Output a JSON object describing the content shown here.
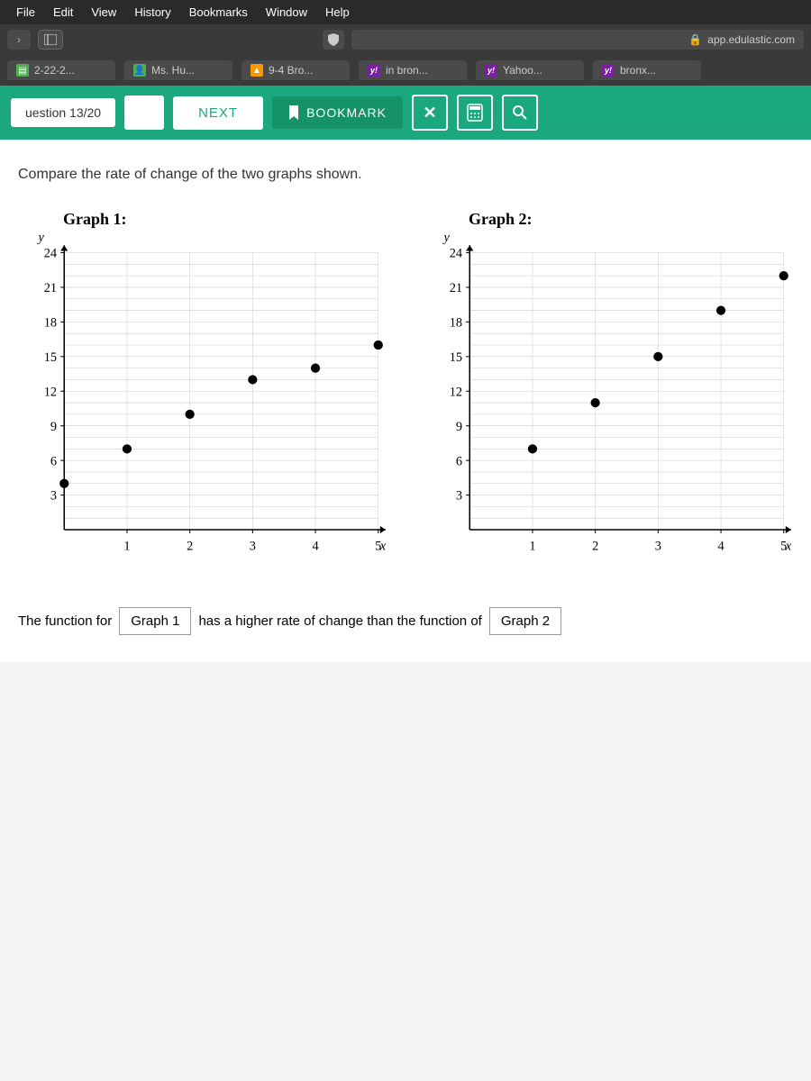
{
  "menu": [
    "File",
    "Edit",
    "View",
    "History",
    "Bookmarks",
    "Window",
    "Help"
  ],
  "url_label": "app.edulastic.com",
  "tabs": [
    {
      "label": "2-22-2...",
      "iconClass": "icon-green",
      "iconChar": "▤"
    },
    {
      "label": "Ms. Hu...",
      "iconClass": "icon-green",
      "iconChar": "👤"
    },
    {
      "label": "9-4 Bro...",
      "iconClass": "icon-orange",
      "iconChar": "▲"
    },
    {
      "label": "in bron...",
      "iconClass": "icon-purple",
      "iconChar": "y!"
    },
    {
      "label": "Yahoo...",
      "iconClass": "icon-purple",
      "iconChar": "y!"
    },
    {
      "label": "bronx...",
      "iconClass": "icon-purple",
      "iconChar": "y!"
    }
  ],
  "toolbar": {
    "question_counter": "uestion 13/20",
    "next_label": "NEXT",
    "bookmark_label": "BOOKMARK"
  },
  "prompt": "Compare the rate of change of the two graphs shown.",
  "graph1_title": "Graph 1:",
  "graph2_title": "Graph 2:",
  "chart_data": [
    {
      "type": "scatter",
      "title": "Graph 1",
      "xlabel": "x",
      "ylabel": "y",
      "xlim": [
        0,
        5
      ],
      "ylim": [
        0,
        24
      ],
      "x_ticks": [
        1,
        2,
        3,
        4,
        5
      ],
      "y_ticks": [
        3,
        6,
        9,
        12,
        15,
        18,
        21,
        24
      ],
      "x": [
        0,
        1,
        2,
        3,
        4,
        5
      ],
      "y": [
        4,
        7,
        10,
        13,
        14,
        16
      ]
    },
    {
      "type": "scatter",
      "title": "Graph 2",
      "xlabel": "x",
      "ylabel": "y",
      "xlim": [
        0,
        5
      ],
      "ylim": [
        0,
        24
      ],
      "x_ticks": [
        1,
        2,
        3,
        4,
        5
      ],
      "y_ticks": [
        3,
        6,
        9,
        12,
        15,
        18,
        21,
        24
      ],
      "x": [
        1,
        2,
        3,
        4,
        5
      ],
      "y": [
        7,
        11,
        15,
        19,
        22
      ]
    }
  ],
  "answer": {
    "prefix": "The function for",
    "select1": "Graph 1",
    "middle": "has a higher rate of change than the function of",
    "select2": "Graph 2"
  }
}
